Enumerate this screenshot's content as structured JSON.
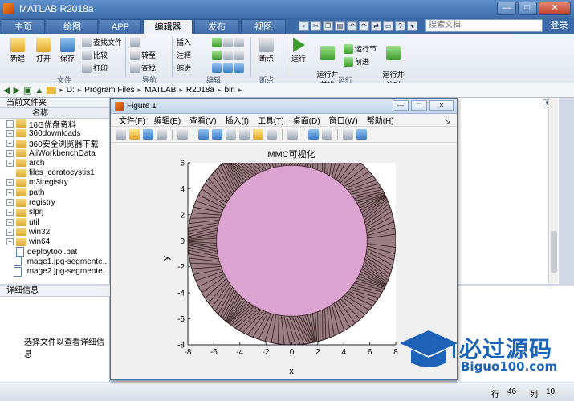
{
  "window": {
    "title": "MATLAB R2018a",
    "minimize": "—",
    "maximize": "□",
    "close": "✕"
  },
  "tabs": [
    "主页",
    "绘图",
    "APP",
    "编辑器",
    "发布",
    "视图"
  ],
  "search": {
    "placeholder": "搜索文档"
  },
  "login": "登录",
  "ribbon": {
    "file": {
      "new": "新建",
      "open": "打开",
      "save": "保存",
      "find_files": "查找文件",
      "compare": "比较",
      "print": "打印",
      "group": "文件"
    },
    "navigate": {
      "goto": "转至",
      "find": "查找",
      "group": "导航"
    },
    "edit": {
      "insert": "插入",
      "comment": "注释",
      "indent": "缩进",
      "group": "编辑"
    },
    "breakpoints": {
      "breakpoints": "断点",
      "group": "断点"
    },
    "run": {
      "run": "运行",
      "run_advance": "运行并\n前进",
      "run_section": "运行节",
      "advance": "前进",
      "run_time": "运行并\n计时",
      "group": "运行"
    }
  },
  "path": {
    "drive": "D:",
    "folders": [
      "Program Files",
      "MATLAB",
      "R2018a",
      "bin"
    ]
  },
  "current_folder": {
    "title": "当前文件夹",
    "column": "名称",
    "items": [
      {
        "name": "16G优盘资料",
        "type": "folder",
        "expand": true
      },
      {
        "name": "360downloads",
        "type": "folder",
        "expand": true
      },
      {
        "name": "360安全浏览器下载",
        "type": "folder",
        "expand": true
      },
      {
        "name": "AliWorkbenchData",
        "type": "folder",
        "expand": true
      },
      {
        "name": "arch",
        "type": "folder",
        "expand": true
      },
      {
        "name": "files_ceratocystis1",
        "type": "folder",
        "expand": false
      },
      {
        "name": "m3iregistry",
        "type": "folder",
        "expand": true
      },
      {
        "name": "path",
        "type": "folder",
        "expand": true
      },
      {
        "name": "registry",
        "type": "folder",
        "expand": true
      },
      {
        "name": "slprj",
        "type": "folder",
        "expand": true
      },
      {
        "name": "util",
        "type": "folder",
        "expand": true
      },
      {
        "name": "win32",
        "type": "folder",
        "expand": true
      },
      {
        "name": "win64",
        "type": "folder",
        "expand": true
      },
      {
        "name": "deploytool.bat",
        "type": "file",
        "expand": false
      },
      {
        "name": "image1.jpg-segmente...",
        "type": "file",
        "expand": false
      },
      {
        "name": "image2.jpg-segmente...",
        "type": "file",
        "expand": false
      }
    ]
  },
  "details": {
    "title": "详细信息",
    "hint": "选择文件以查看详细信息"
  },
  "status": {
    "row_label": "行",
    "row": "46",
    "col_label": "列",
    "col": "10"
  },
  "figure": {
    "title": "Figure 1",
    "menus": [
      "文件(F)",
      "编辑(E)",
      "查看(V)",
      "插入(I)",
      "工具(T)",
      "桌面(D)",
      "窗口(W)",
      "帮助(H)"
    ],
    "plot_title": "MMC可视化",
    "xlabel": "x",
    "ylabel": "y"
  },
  "colors": {
    "inner_fill": "#dba3cf",
    "ring_stroke": "#3a2626",
    "ring_fill": "#9c7f86",
    "accent": "#3f6fac"
  },
  "chart_data": {
    "type": "scatter",
    "title": "MMC可视化",
    "xlabel": "x",
    "ylabel": "y",
    "xlim": [
      -8,
      8
    ],
    "ylim": [
      -8,
      6
    ],
    "xticks": [
      -8,
      -6,
      -4,
      -2,
      0,
      2,
      4,
      6,
      8
    ],
    "yticks": [
      -8,
      -6,
      -4,
      -2,
      0,
      2,
      4,
      6
    ],
    "series": [
      {
        "shape": "filled-circle",
        "center": [
          0,
          0
        ],
        "radius": 5.8
      },
      {
        "shape": "hatched-ring",
        "center": [
          0,
          0
        ],
        "inner_radius": 5.8,
        "outer_radius": 8.0
      }
    ]
  },
  "watermark": {
    "text": "必过源码",
    "sub": "Biguo100.com"
  }
}
